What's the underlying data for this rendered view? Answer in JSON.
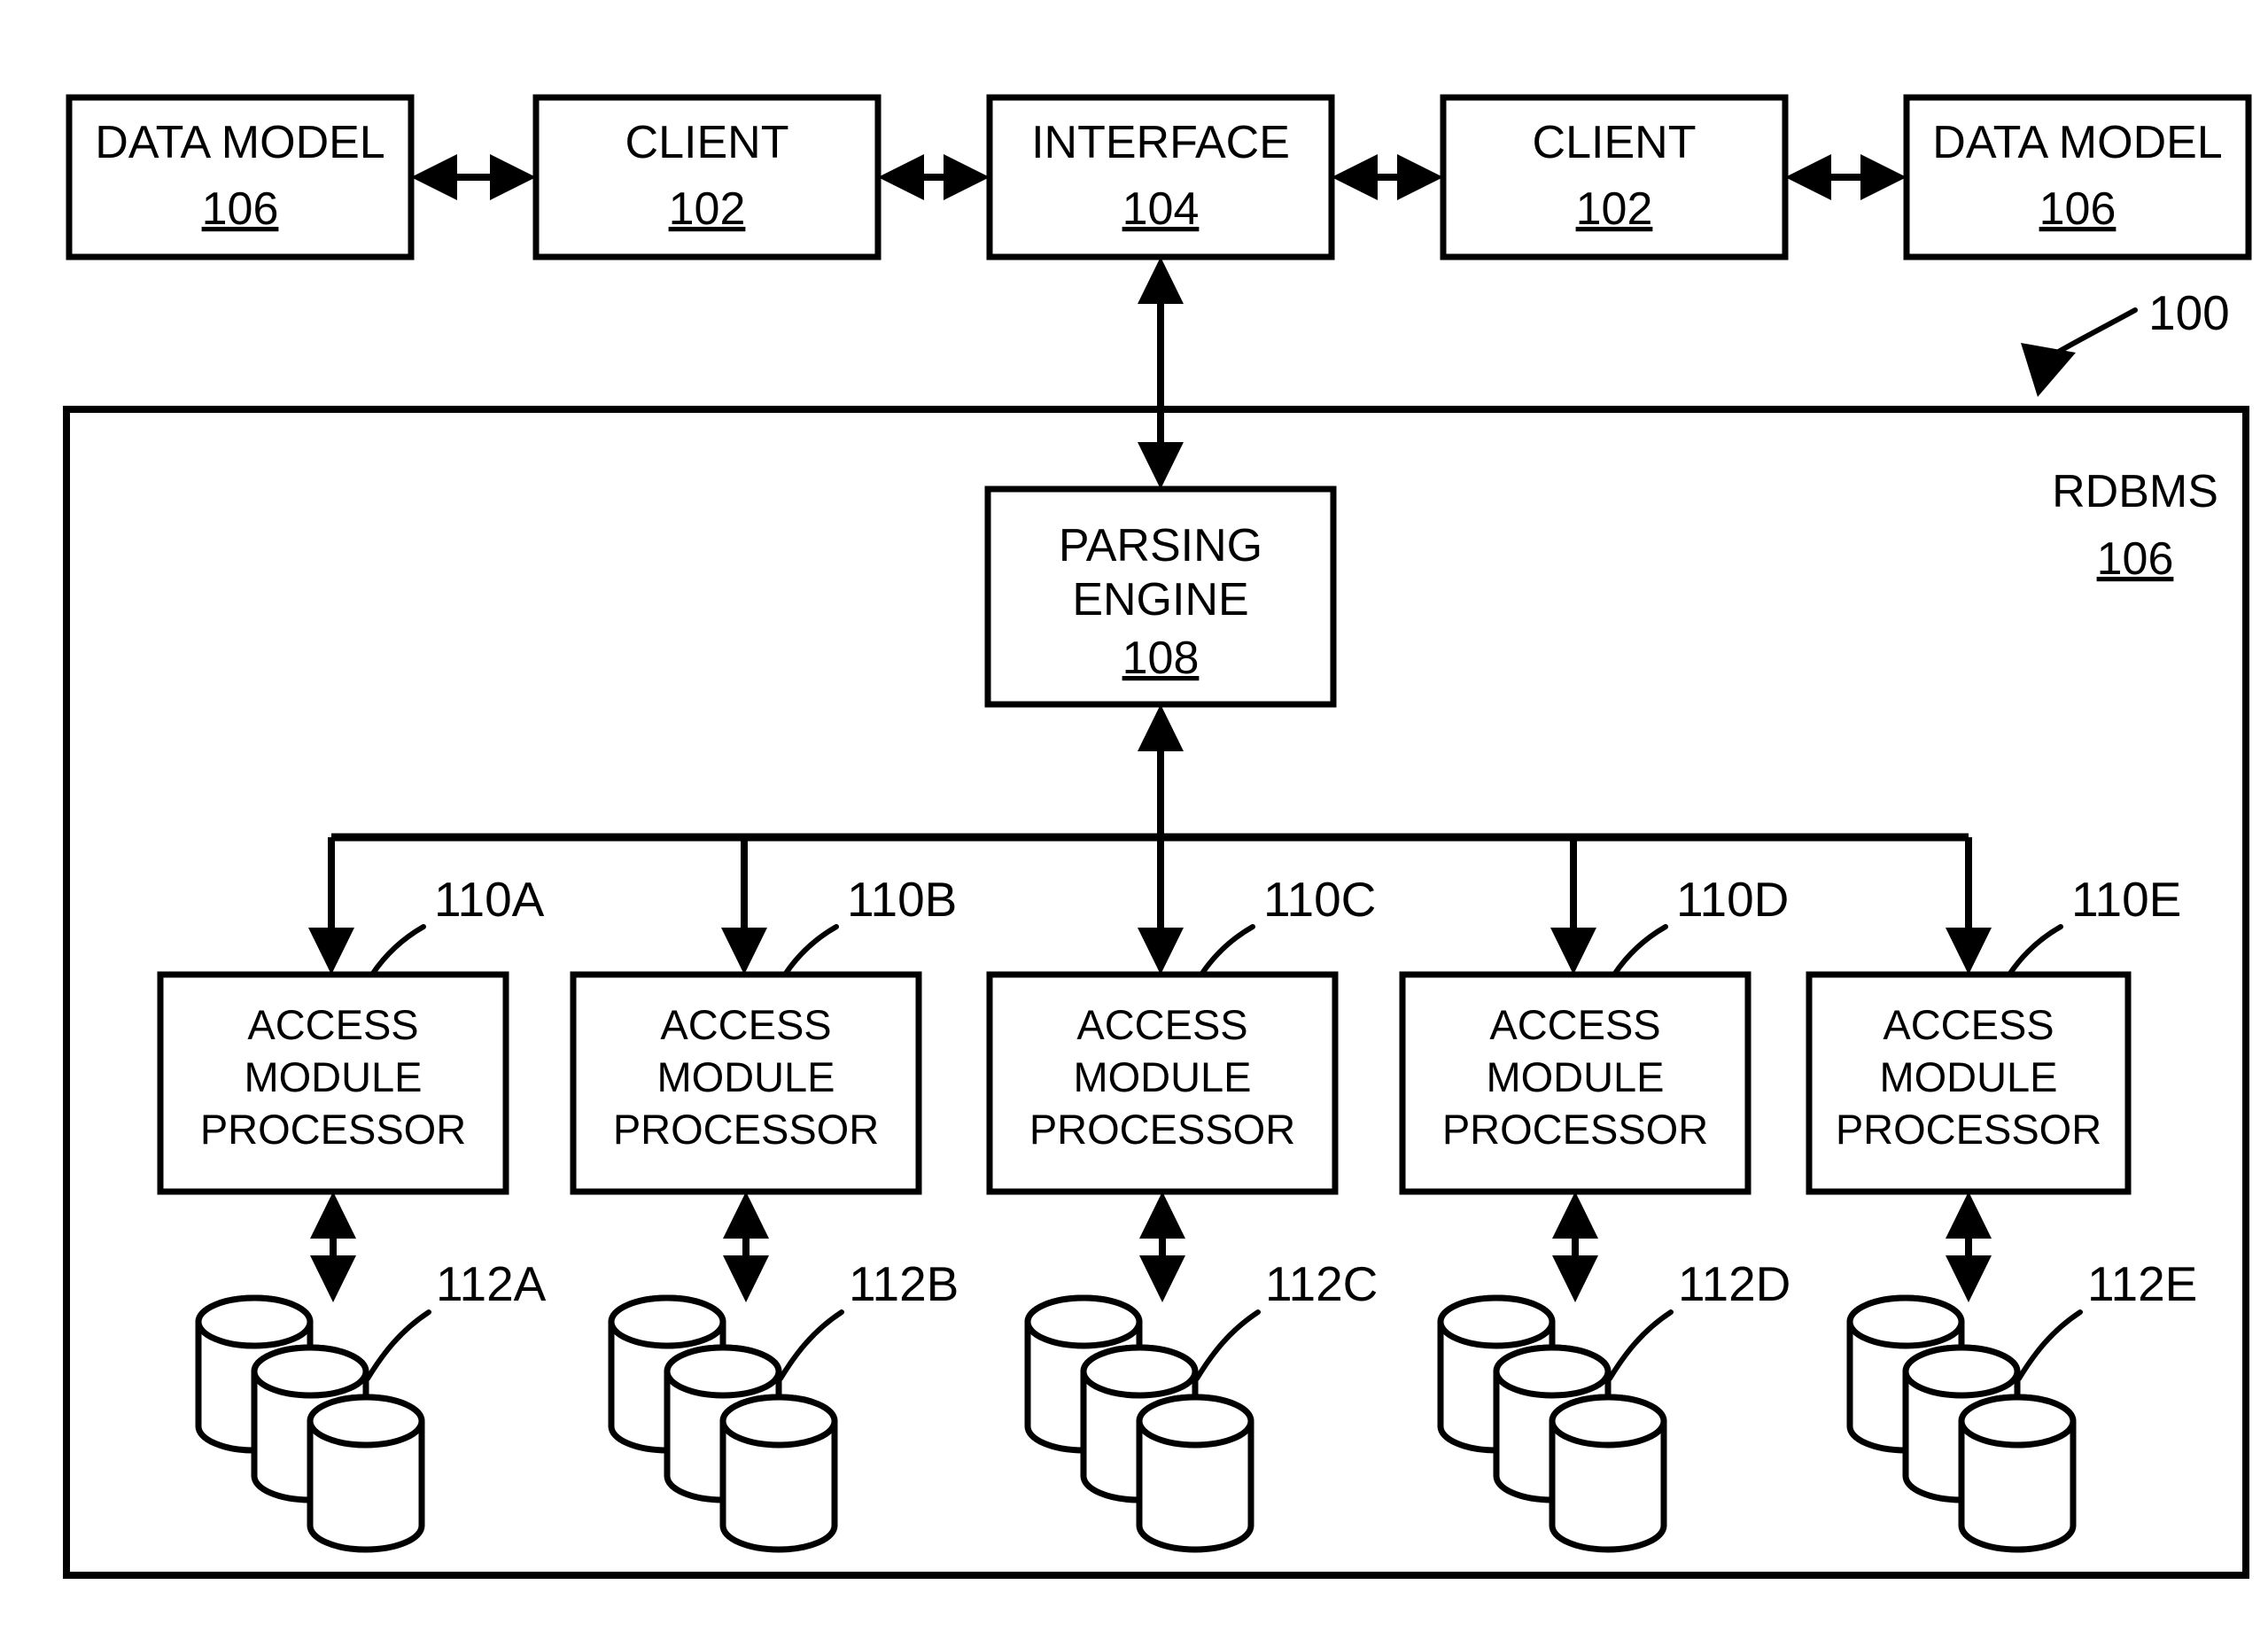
{
  "figure": {
    "reference_numeral": "100",
    "container_label": "RDBMS",
    "container_ref": "106"
  },
  "top_row": [
    {
      "label": "DATA MODEL",
      "ref": "106",
      "name": "data-model-left"
    },
    {
      "label": "CLIENT",
      "ref": "102",
      "name": "client-left"
    },
    {
      "label": "INTERFACE",
      "ref": "104",
      "name": "interface"
    },
    {
      "label": "CLIENT",
      "ref": "102",
      "name": "client-right"
    },
    {
      "label": "DATA MODEL",
      "ref": "106",
      "name": "data-model-right"
    }
  ],
  "parsing_engine": {
    "line1": "PARSING",
    "line2": "ENGINE",
    "ref": "108"
  },
  "amp_line1": "ACCESS",
  "amp_line2": "MODULE",
  "amp_line3": "PROCESSOR",
  "amps": [
    {
      "callout": "110A",
      "disk_callout": "112A"
    },
    {
      "callout": "110B",
      "disk_callout": "112B"
    },
    {
      "callout": "110C",
      "disk_callout": "112C"
    },
    {
      "callout": "110D",
      "disk_callout": "112D"
    },
    {
      "callout": "110E",
      "disk_callout": "112E"
    }
  ],
  "colors": {
    "stroke": "#000000",
    "fill": "#ffffff",
    "background": "#ffffff"
  }
}
